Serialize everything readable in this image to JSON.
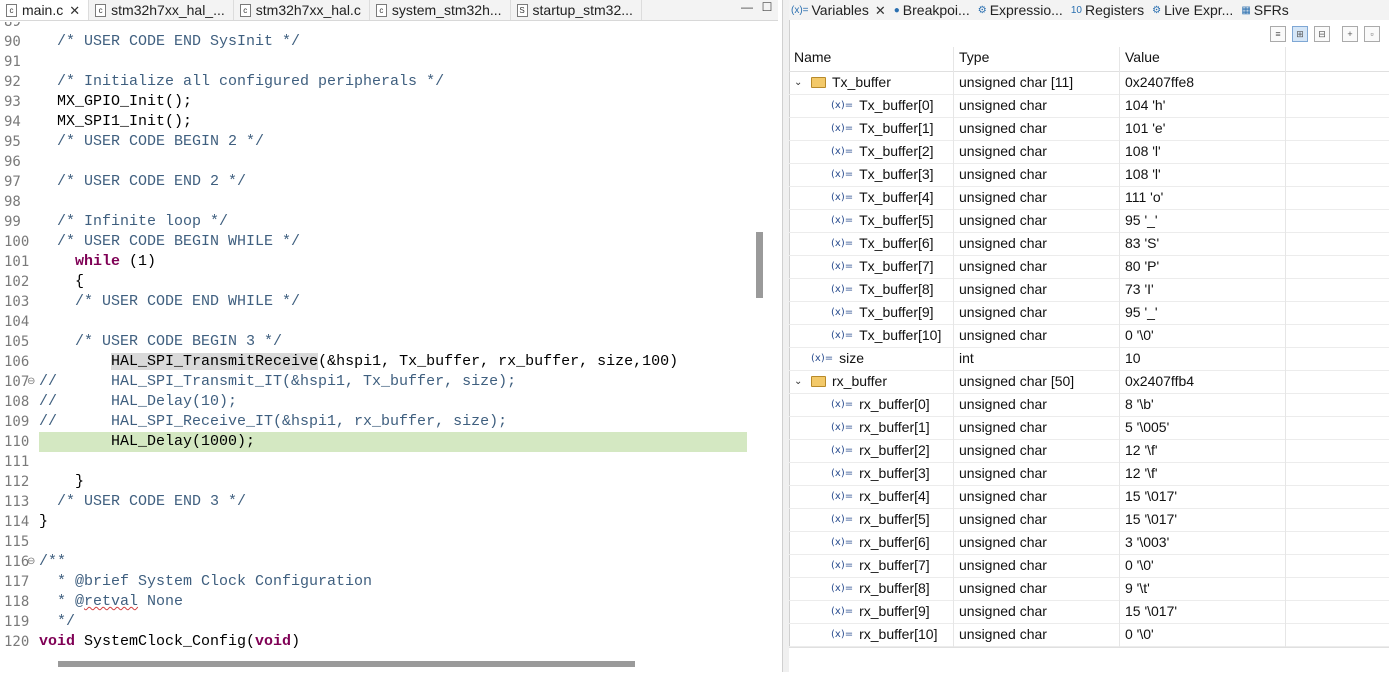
{
  "editor": {
    "tabs": [
      {
        "label": "main.c",
        "icon": "c-file-icon",
        "active": true,
        "close": "✕"
      },
      {
        "label": "stm32h7xx_hal_...",
        "icon": "c-file-icon",
        "active": false
      },
      {
        "label": "stm32h7xx_hal.c",
        "icon": "c-file-icon",
        "active": false
      },
      {
        "label": "system_stm32h...",
        "icon": "c-file-icon",
        "active": false
      },
      {
        "label": "startup_stm32...",
        "icon": "s-file-icon",
        "active": false
      }
    ],
    "lines": [
      {
        "n": "89",
        "t": ""
      },
      {
        "n": "90",
        "t": "  /* USER CODE END SysInit */"
      },
      {
        "n": "91",
        "t": ""
      },
      {
        "n": "92",
        "t": "  /* Initialize all configured peripherals */"
      },
      {
        "n": "93",
        "t": "  MX_GPIO_Init();"
      },
      {
        "n": "94",
        "t": "  MX_SPI1_Init();"
      },
      {
        "n": "95",
        "t": "  /* USER CODE BEGIN 2 */"
      },
      {
        "n": "96",
        "t": ""
      },
      {
        "n": "97",
        "t": "  /* USER CODE END 2 */"
      },
      {
        "n": "98",
        "t": ""
      },
      {
        "n": "99",
        "t": "  /* Infinite loop */"
      },
      {
        "n": "100",
        "t": "  /* USER CODE BEGIN WHILE */"
      },
      {
        "n": "101",
        "t": "    while (1)"
      },
      {
        "n": "102",
        "t": "    {"
      },
      {
        "n": "103",
        "t": "    /* USER CODE END WHILE */"
      },
      {
        "n": "104",
        "t": ""
      },
      {
        "n": "105",
        "t": "    /* USER CODE BEGIN 3 */"
      },
      {
        "n": "106",
        "t": "        HAL_SPI_TransmitReceive(&hspi1, Tx_buffer, rx_buffer, size,100)"
      },
      {
        "n": "107",
        "t": "//      HAL_SPI_Transmit_IT(&hspi1, Tx_buffer, size);"
      },
      {
        "n": "108",
        "t": "//      HAL_Delay(10);"
      },
      {
        "n": "109",
        "t": "//      HAL_SPI_Receive_IT(&hspi1, rx_buffer, size);"
      },
      {
        "n": "110",
        "t": "        HAL_Delay(1000);"
      },
      {
        "n": "111",
        "t": ""
      },
      {
        "n": "112",
        "t": "    }"
      },
      {
        "n": "113",
        "t": "  /* USER CODE END 3 */"
      },
      {
        "n": "114",
        "t": "}"
      },
      {
        "n": "115",
        "t": ""
      },
      {
        "n": "116",
        "t": "/**"
      },
      {
        "n": "117",
        "t": "  * @brief System Clock Configuration"
      },
      {
        "n": "118",
        "t": "  * @retval None"
      },
      {
        "n": "119",
        "t": "  */"
      },
      {
        "n": "120",
        "t": "void SystemClock_Config(void)"
      }
    ]
  },
  "variables_view": {
    "tabs": [
      {
        "label": "Variables",
        "icon": "variables-icon",
        "close": "✕"
      },
      {
        "label": "Breakpoi...",
        "icon": "breakpoints-icon"
      },
      {
        "label": "Expressio...",
        "icon": "expressions-icon"
      },
      {
        "label": "Registers",
        "icon": "registers-icon"
      },
      {
        "label": "Live Expr...",
        "icon": "live-expressions-icon"
      },
      {
        "label": "SFRs",
        "icon": "sfrs-icon"
      }
    ],
    "columns": [
      "Name",
      "Type",
      "Value"
    ],
    "rows": [
      {
        "name": "Tx_buffer",
        "type": "unsigned char [11]",
        "value": "0x2407ffe8",
        "level": 0,
        "kind": "struct",
        "expand": "⌄"
      },
      {
        "name": "Tx_buffer[0]",
        "type": "unsigned char",
        "value": "104 'h'",
        "level": 1
      },
      {
        "name": "Tx_buffer[1]",
        "type": "unsigned char",
        "value": "101 'e'",
        "level": 1
      },
      {
        "name": "Tx_buffer[2]",
        "type": "unsigned char",
        "value": "108 'l'",
        "level": 1
      },
      {
        "name": "Tx_buffer[3]",
        "type": "unsigned char",
        "value": "108 'l'",
        "level": 1
      },
      {
        "name": "Tx_buffer[4]",
        "type": "unsigned char",
        "value": "111 'o'",
        "level": 1
      },
      {
        "name": "Tx_buffer[5]",
        "type": "unsigned char",
        "value": "95 '_'",
        "level": 1
      },
      {
        "name": "Tx_buffer[6]",
        "type": "unsigned char",
        "value": "83 'S'",
        "level": 1
      },
      {
        "name": "Tx_buffer[7]",
        "type": "unsigned char",
        "value": "80 'P'",
        "level": 1
      },
      {
        "name": "Tx_buffer[8]",
        "type": "unsigned char",
        "value": "73 'I'",
        "level": 1
      },
      {
        "name": "Tx_buffer[9]",
        "type": "unsigned char",
        "value": "95 '_'",
        "level": 1
      },
      {
        "name": "Tx_buffer[10]",
        "type": "unsigned char",
        "value": "0 '\\0'",
        "level": 1
      },
      {
        "name": "size",
        "type": "int",
        "value": "10",
        "level": 0,
        "kind": "var"
      },
      {
        "name": "rx_buffer",
        "type": "unsigned char [50]",
        "value": "0x2407ffb4",
        "level": 0,
        "kind": "struct",
        "expand": "⌄"
      },
      {
        "name": "rx_buffer[0]",
        "type": "unsigned char",
        "value": "8 '\\b'",
        "level": 1
      },
      {
        "name": "rx_buffer[1]",
        "type": "unsigned char",
        "value": "5 '\\005'",
        "level": 1
      },
      {
        "name": "rx_buffer[2]",
        "type": "unsigned char",
        "value": "12 '\\f'",
        "level": 1
      },
      {
        "name": "rx_buffer[3]",
        "type": "unsigned char",
        "value": "12 '\\f'",
        "level": 1
      },
      {
        "name": "rx_buffer[4]",
        "type": "unsigned char",
        "value": "15 '\\017'",
        "level": 1
      },
      {
        "name": "rx_buffer[5]",
        "type": "unsigned char",
        "value": "15 '\\017'",
        "level": 1
      },
      {
        "name": "rx_buffer[6]",
        "type": "unsigned char",
        "value": "3 '\\003'",
        "level": 1
      },
      {
        "name": "rx_buffer[7]",
        "type": "unsigned char",
        "value": "0 '\\0'",
        "level": 1
      },
      {
        "name": "rx_buffer[8]",
        "type": "unsigned char",
        "value": "9 '\\t'",
        "level": 1
      },
      {
        "name": "rx_buffer[9]",
        "type": "unsigned char",
        "value": "15 '\\017'",
        "level": 1
      },
      {
        "name": "rx_buffer[10]",
        "type": "unsigned char",
        "value": "0 '\\0'",
        "level": 1
      }
    ]
  },
  "colors": {
    "current_line": "#d4e8c2",
    "comment": "#3f5f7f",
    "keyword": "#7f0055"
  }
}
